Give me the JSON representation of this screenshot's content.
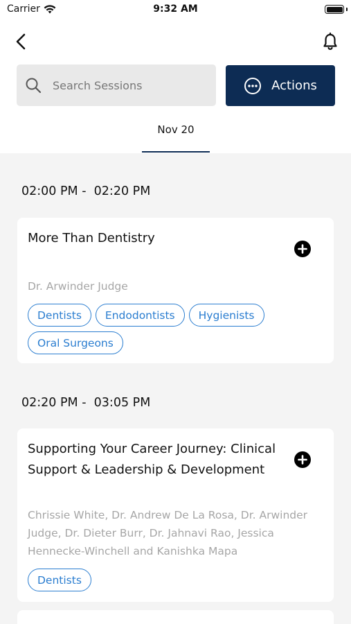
{
  "status_bar": {
    "carrier": "Carrier",
    "time": "9:32 AM"
  },
  "search": {
    "placeholder": "Search Sessions"
  },
  "actions_button": {
    "label": "Actions"
  },
  "date_tab": {
    "label": "Nov 20"
  },
  "sessions": [
    {
      "time_range": "02:00 PM -  02:20 PM",
      "title": "More Than Dentistry",
      "speakers": "Dr. Arwinder Judge",
      "tags": [
        "Dentists",
        "Endodontists",
        "Hygienists",
        "Oral Surgeons"
      ]
    },
    {
      "time_range": "02:20 PM -  03:05 PM",
      "title": "Supporting Your Career Journey: Clinical Support & Leadership & Development",
      "speakers": "Chrissie White, Dr. Andrew De La Rosa, Dr. Arwinder Judge, Dr. Dieter Burr, Dr. Jahnavi Rao, Jessica Hennecke-Winchell and Kanishka Mapa",
      "tags": [
        "Dentists"
      ]
    }
  ],
  "colors": {
    "accent": "#0d2c54",
    "tag": "#2a7dd0",
    "background": "#f4f4f4"
  },
  "icons": {
    "back": "chevron-left-icon",
    "bell": "bell-icon",
    "search": "search-icon",
    "actions": "ellipsis-circle-icon",
    "add": "plus-circle-icon"
  }
}
